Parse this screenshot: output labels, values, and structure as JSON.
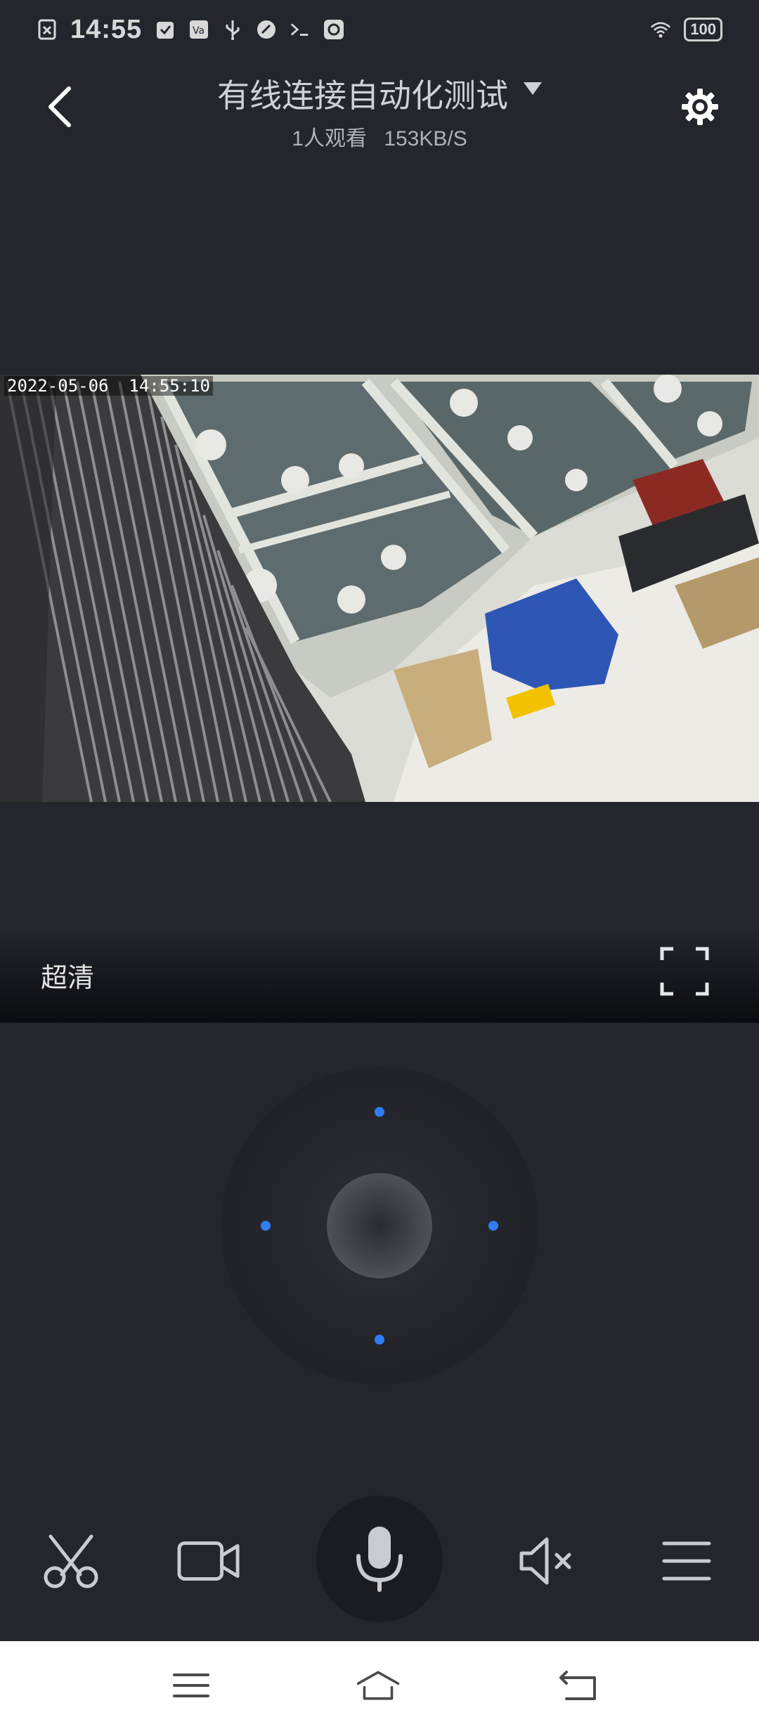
{
  "status_bar": {
    "time": "14:55",
    "battery": "100",
    "icons": [
      "sim-card-icon",
      "app-icon",
      "app-icon",
      "usb-icon",
      "app-icon",
      "terminal-icon",
      "app-icon",
      "wifi-icon",
      "battery-icon"
    ]
  },
  "header": {
    "title": "有线连接自动化测试",
    "viewers": "1人观看",
    "bitrate": "153KB/S"
  },
  "video": {
    "timestamp": "2022-05-06  14:55:10"
  },
  "quality": {
    "label": "超清"
  },
  "ptz": {
    "accent": "#2f7cf6"
  },
  "toolbar": {
    "items": [
      "scissors-icon",
      "video-record-icon",
      "microphone-icon",
      "mute-icon",
      "menu-icon"
    ]
  },
  "nav_bar": {
    "items": [
      "menu-icon",
      "home-icon",
      "back-icon"
    ]
  }
}
